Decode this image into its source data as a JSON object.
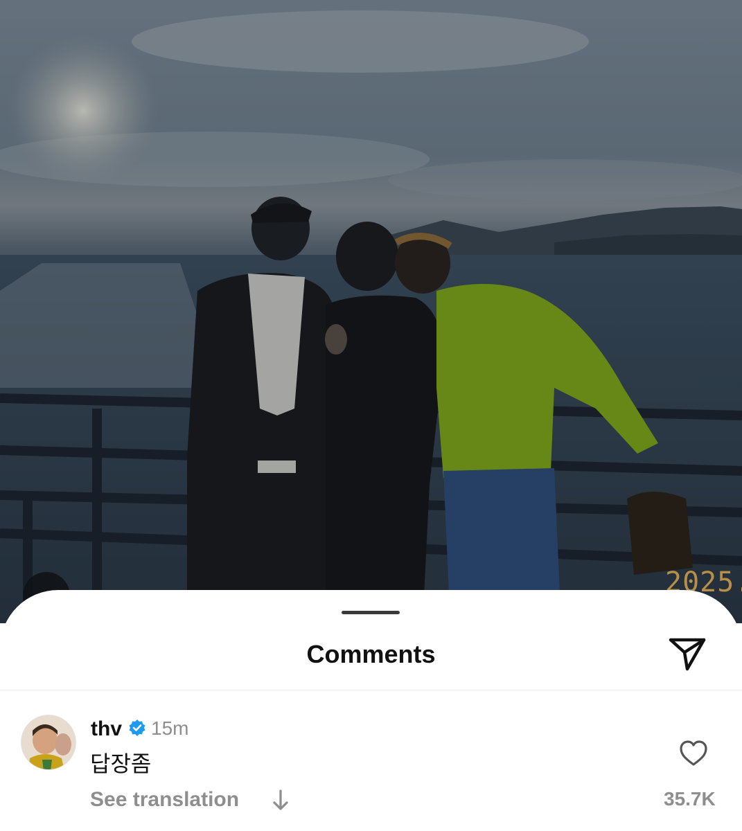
{
  "photo": {
    "date_stamp": "2025.",
    "description_icon": "photo-backdrop"
  },
  "sheet": {
    "title": "Comments",
    "share_icon": "paper-plane-icon"
  },
  "comment": {
    "username": "thv",
    "verified": true,
    "time": "15m",
    "text": "답장좀",
    "see_translation": "See translation",
    "like_count": "35.7K",
    "like_icon": "heart-outline-icon"
  },
  "colors": {
    "verified_blue": "#1d9bf0",
    "muted_text": "#8e8e8e",
    "date_stamp": "#c89a4a"
  }
}
